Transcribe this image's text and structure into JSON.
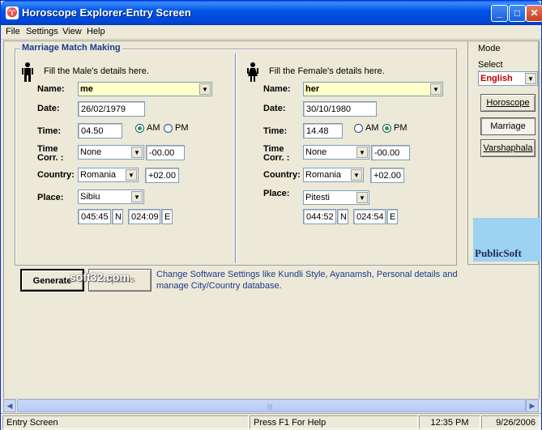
{
  "window": {
    "title": "Horoscope Explorer-Entry Screen",
    "app_icon": "horoscope-app-icon"
  },
  "menu": [
    "File",
    "Settings",
    "View",
    "Help"
  ],
  "section": {
    "title": "Marriage Match Making"
  },
  "male": {
    "fill_label": "Fill the Male's details here.",
    "name_label": "Name:",
    "name_value": "me",
    "date_label": "Date:",
    "date_value": "26/02/1979",
    "time_label": "Time:",
    "time_value": "04.50",
    "am_label": "AM",
    "pm_label": "PM",
    "meridiem_selected": "AM",
    "timecorr_label_1": "Time",
    "timecorr_label_2": "Corr. :",
    "timecorr_value": "None",
    "timecorr_offset": "-00.00",
    "country_label": "Country:",
    "country_value": "Romania",
    "country_offset": "+02.00",
    "place_label": "Place:",
    "place_value": "Sibiu",
    "lat_value": "045:45",
    "lat_dir": "N",
    "lon_value": "024:09",
    "lon_dir": "E"
  },
  "female": {
    "fill_label": "Fill the Female's details here.",
    "name_label": "Name:",
    "name_value": "her",
    "date_label": "Date:",
    "date_value": "30/10/1980",
    "time_label": "Time:",
    "time_value": "14.48",
    "am_label": "AM",
    "pm_label": "PM",
    "meridiem_selected": "PM",
    "timecorr_label_1": "Time",
    "timecorr_label_2": "Corr. :",
    "timecorr_value": "None",
    "timecorr_offset": "-00.00",
    "country_label": "Country:",
    "country_value": "Romania",
    "country_offset": "+02.00",
    "place_label": "Place:",
    "place_value": "Pitesti",
    "lat_value": "044:52",
    "lat_dir": "N",
    "lon_value": "024:54",
    "lon_dir": "E"
  },
  "mode": {
    "title": "Mode",
    "language_label": "Select Language",
    "language_value": "English",
    "buttons": [
      "Horoscope",
      "Marriage",
      "Varshaphala"
    ],
    "selected": "Marriage"
  },
  "ad_text": "PublicSoft",
  "actions": {
    "generate": "Generate",
    "options": "Options"
  },
  "watermark": "soft32.com",
  "info_text": "Change Software Settings like Kundli Style, Ayanamsh, Personal details and manage City/Country database.",
  "status": {
    "screen": "Entry Screen",
    "hint": "Press F1 For Help",
    "time": "12:35 PM",
    "date": "9/26/2006"
  },
  "colors": {
    "accent": "#1c3a8c",
    "title_bar": "#0055e5",
    "language_text": "#c00000",
    "name_field": "#ffffc8"
  }
}
